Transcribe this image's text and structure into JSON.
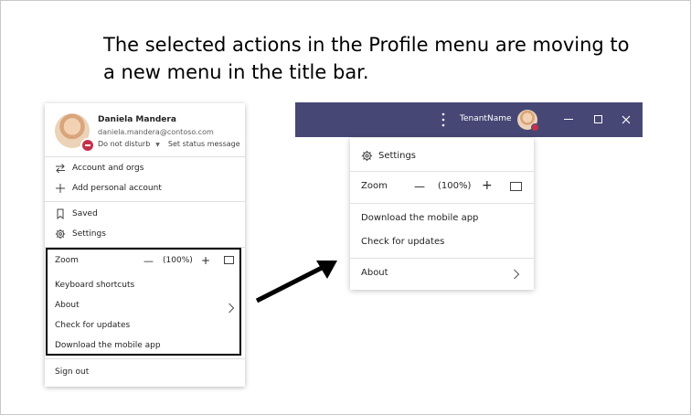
{
  "caption": {
    "line1": "The selected actions in the Profile menu are moving to",
    "line2": "a new menu in the title bar."
  },
  "profile_menu": {
    "user_name": "Daniela Mandera",
    "user_email": "daniela.mandera@contoso.com",
    "status": "Do not disturb",
    "set_status": "Set status message",
    "account_orgs": "Account and orgs",
    "add_personal_account": "Add personal account",
    "saved": "Saved",
    "settings": "Settings",
    "zoom_label": "Zoom",
    "zoom_minus": "—",
    "zoom_value": "(100%)",
    "zoom_plus": "+",
    "keyboard_shortcuts": "Keyboard shortcuts",
    "about": "About",
    "check_updates": "Check for updates",
    "download_app": "Download the mobile app",
    "sign_out": "Sign out"
  },
  "title_bar": {
    "tenant_name": "TenantName",
    "color": "#464775"
  },
  "new_menu": {
    "settings": "Settings",
    "zoom_label": "Zoom",
    "zoom_minus": "—",
    "zoom_value": "(100%)",
    "zoom_plus": "+",
    "download_app": "Download the mobile app",
    "check_updates": "Check for updates",
    "about": "About"
  },
  "icons": [
    "swap-icon",
    "plus-icon",
    "bookmark-icon",
    "gear-icon",
    "fullscreen-icon",
    "chevron-right-icon",
    "more-options-icon",
    "minimize-icon",
    "maximize-icon",
    "close-icon"
  ]
}
